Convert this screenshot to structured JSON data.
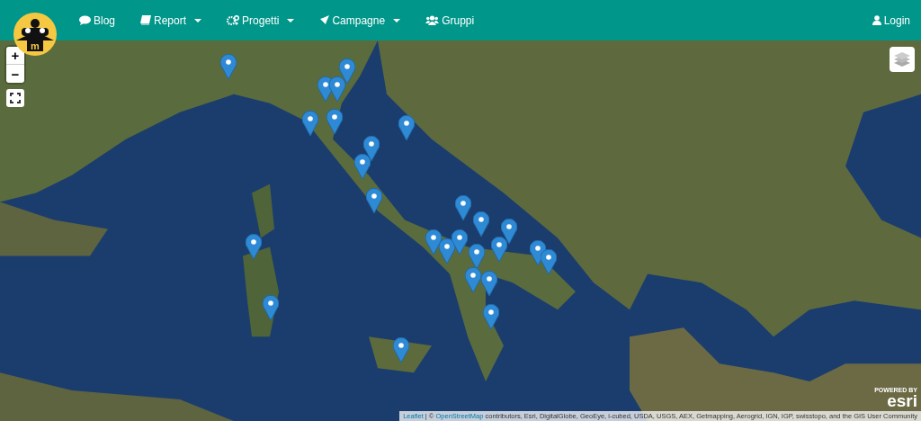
{
  "navbar": {
    "logo_text": "m",
    "items": [
      {
        "label": "Blog",
        "dropdown": false
      },
      {
        "label": "Report",
        "dropdown": true
      },
      {
        "label": "Progetti",
        "dropdown": true
      },
      {
        "label": "Campagne",
        "dropdown": true
      },
      {
        "label": "Gruppi",
        "dropdown": false
      }
    ],
    "login": "Login"
  },
  "map": {
    "zoom_in": "+",
    "zoom_out": "−",
    "esri": {
      "powered": "POWERED BY",
      "name": "esri"
    },
    "attribution": {
      "leaflet": "Leaflet",
      "separator": "| ©",
      "osm": "OpenStreetMap",
      "text": "contributors, Esri, DigitalGlobe, GeoEye, i-cubed, USDA, USGS, AEX, Getmapping, Aerogrid, IGN, IGP, swisstopo, and the GIS User Community"
    }
  }
}
